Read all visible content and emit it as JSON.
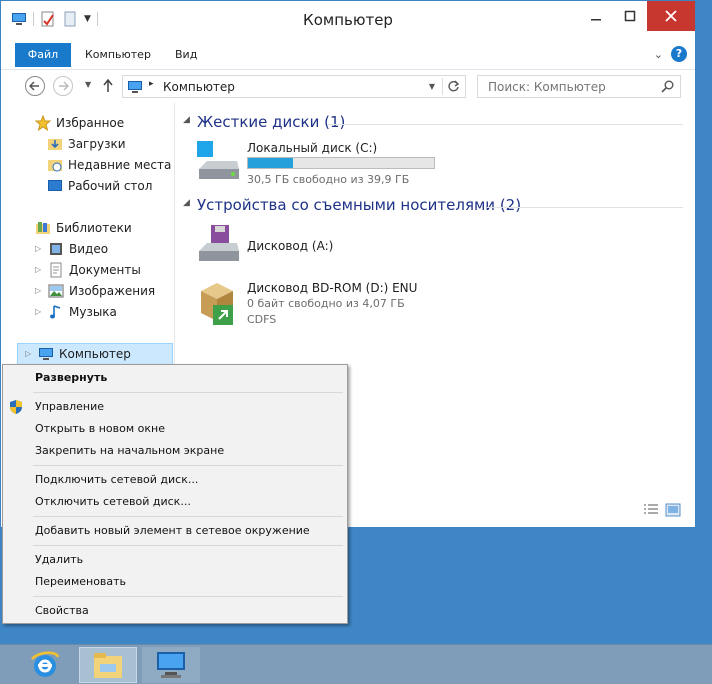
{
  "window": {
    "title": "Компьютер",
    "ribbon_tabs": [
      "Файл",
      "Компьютер",
      "Вид"
    ]
  },
  "navbar": {
    "address": "Компьютер",
    "search_placeholder": "Поиск: Компьютер"
  },
  "navpane": {
    "favorites": "Избранное",
    "fav_items": [
      "Загрузки",
      "Недавние места",
      "Рабочий стол"
    ],
    "libraries": "Библиотеки",
    "lib_items": [
      "Видео",
      "Документы",
      "Изображения",
      "Музыка"
    ],
    "computer": "Компьютер"
  },
  "content": {
    "group_hdd": "Жесткие диски (1)",
    "group_removable": "Устройства со съемными носителями (2)",
    "drive_c": {
      "name": "Локальный диск (C:)",
      "info": "30,5 ГБ свободно из 39,9 ГБ",
      "used_fraction": 0.24
    },
    "drive_a": {
      "name": "Дисковод (A:)"
    },
    "drive_d": {
      "name": "Дисковод BD-ROM (D:) ENU",
      "info": "0 байт свободно из 4,07 ГБ",
      "fs": "CDFS"
    }
  },
  "context_menu": {
    "expand": "Развернуть",
    "manage": "Управление",
    "open_new": "Открыть в новом окне",
    "pin_start": "Закрепить на начальном экране",
    "map_drive": "Подключить сетевой диск...",
    "disconnect_drive": "Отключить сетевой диск...",
    "add_network": "Добавить новый элемент в сетевое окружение",
    "delete": "Удалить",
    "rename": "Переименовать",
    "properties": "Свойства"
  },
  "colors": {
    "accent": "#1979ca",
    "close": "#c7372f",
    "desktop": "#3f86c6",
    "bar_fill": "#26a0da"
  }
}
